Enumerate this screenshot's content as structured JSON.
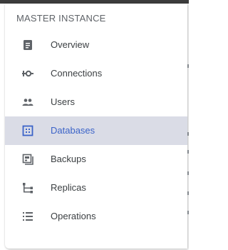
{
  "sidebar": {
    "section_title": "MASTER INSTANCE",
    "items": [
      {
        "label": "Overview",
        "icon": "overview-icon",
        "active": false
      },
      {
        "label": "Connections",
        "icon": "connections-icon",
        "active": false
      },
      {
        "label": "Users",
        "icon": "users-icon",
        "active": false
      },
      {
        "label": "Databases",
        "icon": "databases-icon",
        "active": true
      },
      {
        "label": "Backups",
        "icon": "backups-icon",
        "active": false
      },
      {
        "label": "Replicas",
        "icon": "replicas-icon",
        "active": false
      },
      {
        "label": "Operations",
        "icon": "operations-icon",
        "active": false
      }
    ]
  },
  "colors": {
    "active_bg": "#dadce6",
    "active_text": "#3b63c8",
    "text": "#3c4043",
    "icon": "#5f6368"
  }
}
